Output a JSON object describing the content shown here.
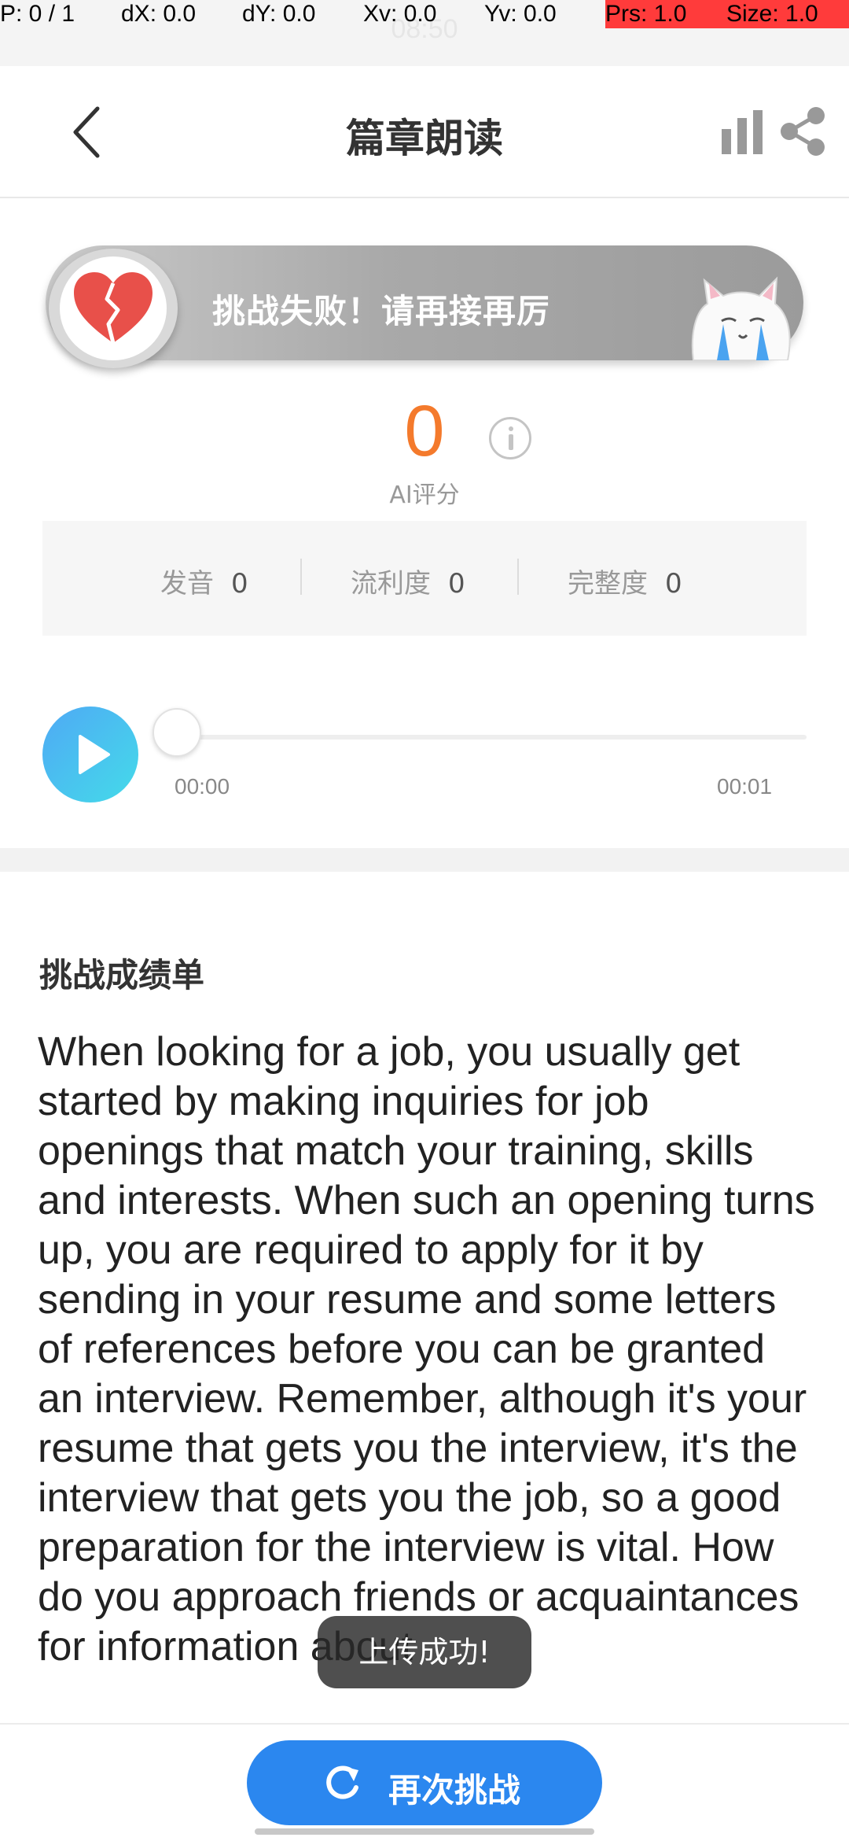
{
  "debug": {
    "pointer": "P: 0 / 1",
    "dx": "dX: 0.0",
    "dy": "dY: 0.0",
    "xv": "Xv: 0.0",
    "yv": "Yv: 0.0",
    "prs": "Prs: 1.0",
    "size": "Size: 1.0"
  },
  "statusbar": {
    "time": "08:50"
  },
  "header": {
    "title": "篇章朗读",
    "back_icon": "chevron-left-icon",
    "stats_icon": "bar-chart-icon",
    "share_icon": "share-icon"
  },
  "result": {
    "message": "挑战失败！请再接再厉",
    "badge_icon": "broken-heart-icon",
    "mascot_icon": "crying-cat-icon"
  },
  "score": {
    "value": "0",
    "label": "AI评分",
    "info_icon": "info-icon"
  },
  "metrics": [
    {
      "label": "发音",
      "value": "0"
    },
    {
      "label": "流利度",
      "value": "0"
    },
    {
      "label": "完整度",
      "value": "0"
    }
  ],
  "player": {
    "current_time": "00:00",
    "total_time": "00:01",
    "progress": 0,
    "play_icon": "play-icon"
  },
  "report": {
    "title": "挑战成绩单",
    "passage": "When looking for a job, you usually get started by making inquiries for job openings that match your training, skills and interests. When such an opening turns up, you are required to apply for it by sending in your resume and some letters of references before you can be granted an interview. Remember, although it's your resume that gets you the interview, it's the interview that gets you the job, so a good preparation for the interview is vital. How do you approach friends or acquaintances for information about"
  },
  "toast": {
    "message": "上传成功!"
  },
  "footer": {
    "retry_label": "再次挑战",
    "retry_icon": "refresh-icon"
  },
  "colors": {
    "accent_blue": "#2b87ef",
    "score_orange": "#f47a2c",
    "debug_red": "#ff3b3b"
  }
}
